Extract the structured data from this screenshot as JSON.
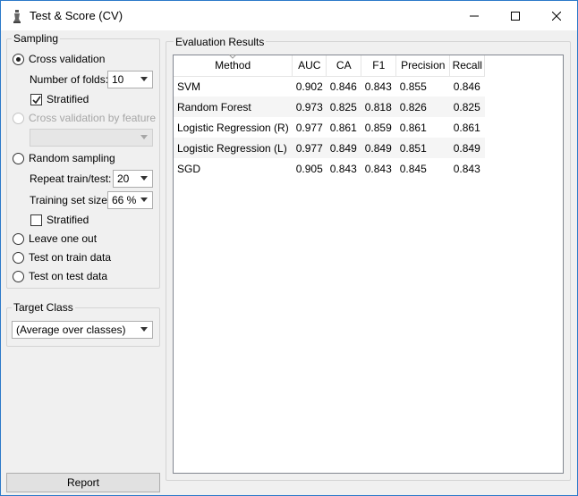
{
  "window": {
    "title": "Test & Score (CV)",
    "icon": "orange-app-icon"
  },
  "sampling": {
    "title": "Sampling",
    "options": {
      "cross_validation": "Cross validation",
      "number_of_folds_label": "Number of folds:",
      "number_of_folds_value": "10",
      "stratified_label": "Stratified",
      "stratified_checked": true,
      "cross_validation_by_feature": "Cross validation by feature",
      "feature_value": "",
      "random_sampling": "Random sampling",
      "repeat_label": "Repeat train/test:",
      "repeat_value": "20",
      "training_size_label": "Training set size:",
      "training_size_value": "66 %",
      "random_stratified_label": "Stratified",
      "random_stratified_checked": false,
      "leave_one_out": "Leave one out",
      "test_on_train": "Test on train data",
      "test_on_test": "Test on test data"
    },
    "selected": "cross_validation"
  },
  "target_class": {
    "title": "Target Class",
    "value": "(Average over classes)"
  },
  "report_button": "Report",
  "evaluation": {
    "title": "Evaluation Results",
    "columns": [
      "Method",
      "AUC",
      "CA",
      "F1",
      "Precision",
      "Recall"
    ],
    "sorted_column": "Method",
    "rows": [
      {
        "method": "SVM",
        "auc": "0.902",
        "ca": "0.846",
        "f1": "0.843",
        "precision": "0.855",
        "recall": "0.846"
      },
      {
        "method": "Random Forest",
        "auc": "0.973",
        "ca": "0.825",
        "f1": "0.818",
        "precision": "0.826",
        "recall": "0.825"
      },
      {
        "method": "Logistic Regression (R)",
        "auc": "0.977",
        "ca": "0.861",
        "f1": "0.859",
        "precision": "0.861",
        "recall": "0.861"
      },
      {
        "method": "Logistic Regression (L)",
        "auc": "0.977",
        "ca": "0.849",
        "f1": "0.849",
        "precision": "0.851",
        "recall": "0.849"
      },
      {
        "method": "SGD",
        "auc": "0.905",
        "ca": "0.843",
        "f1": "0.843",
        "precision": "0.845",
        "recall": "0.843"
      }
    ]
  },
  "colors": {
    "accent": "#2b79c9",
    "row_alt": "#f5f5f5"
  }
}
